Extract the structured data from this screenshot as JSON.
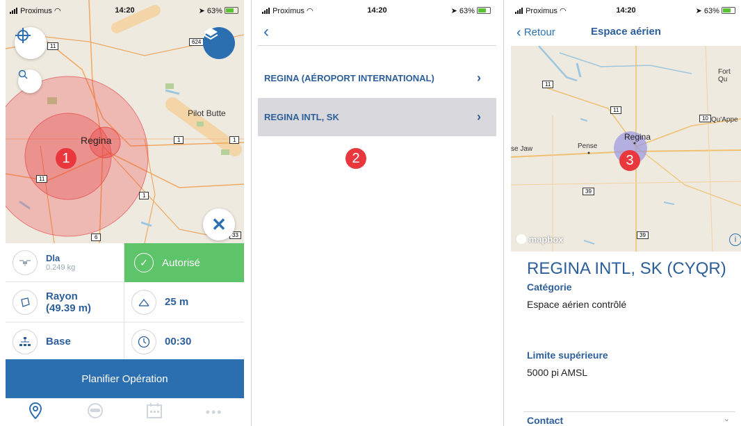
{
  "status": {
    "carrier": "Proximus",
    "time": "14:20",
    "battery": "63%"
  },
  "screen1": {
    "map_labels": {
      "city": "Regina",
      "landmark": "Pilot Butte",
      "hwy11a": "11",
      "hwy11b": "11",
      "hwy1a": "1",
      "hwy1b": "1",
      "hwy1c": "1",
      "hwy6": "6",
      "hwy33": "33",
      "hwy624": "624"
    },
    "marker": "1",
    "drone": {
      "name": "Dla",
      "weight": "0.249 kg"
    },
    "status_label": "Autorisé",
    "radius": {
      "label": "Rayon",
      "value": "(49.39 m)"
    },
    "altitude": "25 m",
    "base": "Base",
    "duration": "00:30",
    "plan_button": "Planifier Opération",
    "tabs": [
      "map",
      "pilot",
      "calendar",
      "more"
    ],
    "colors": {
      "accent": "#2c6fb1",
      "authorized": "#5dc46a",
      "zone": "#e8383d"
    }
  },
  "screen2": {
    "items": [
      {
        "label": "REGINA (AÉROPORT INTERNATIONAL)"
      },
      {
        "label": "REGINA INTL, SK"
      }
    ],
    "marker": "2"
  },
  "screen3": {
    "back": "Retour",
    "title": "Espace aérien",
    "map_labels": {
      "city": "Regina",
      "pense": "Pense",
      "moosejaw": "se Jaw",
      "fortqu": "Fort Qu",
      "quappe": "Qu'Appe",
      "hwy11a": "11",
      "hwy11b": "11",
      "hwy10": "10",
      "hwy39a": "39",
      "hwy39b": "39",
      "attribution": "mapbox"
    },
    "marker": "3",
    "airspace_name": "REGINA INTL, SK (CYQR)",
    "category_label": "Catégorie",
    "category_value": "Espace aérien contrôlé",
    "upper_limit_label": "Limite supérieure",
    "upper_limit_value": "5000 pi AMSL",
    "contact_label": "Contact"
  }
}
